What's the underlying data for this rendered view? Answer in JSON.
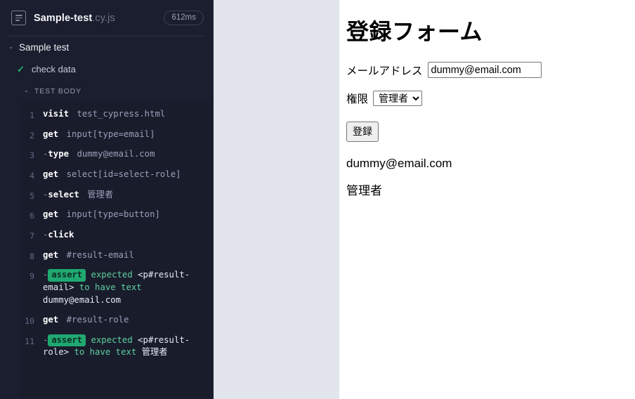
{
  "runner": {
    "spec": {
      "icon": "file-document-icon",
      "name": "Sample-test",
      "extension": ".cy.js",
      "duration": "612ms"
    },
    "suite": {
      "chevron": "⌄",
      "label": "Sample test"
    },
    "test": {
      "status_icon": "✓",
      "label": "check data"
    },
    "hooks": {
      "chevron": "⌄",
      "label": "TEST BODY"
    },
    "commands": [
      {
        "num": "1",
        "dash": "",
        "name": "visit",
        "message": "test_cypress.html",
        "type": "parent"
      },
      {
        "num": "2",
        "dash": "",
        "name": "get",
        "message": "input[type=email]",
        "type": "parent"
      },
      {
        "num": "3",
        "dash": "-",
        "name": "type",
        "message": "dummy@email.com",
        "type": "child"
      },
      {
        "num": "4",
        "dash": "",
        "name": "get",
        "message": "select[id=select-role]",
        "type": "parent"
      },
      {
        "num": "5",
        "dash": "-",
        "name": "select",
        "message": "管理者",
        "type": "child"
      },
      {
        "num": "6",
        "dash": "",
        "name": "get",
        "message": "input[type=button]",
        "type": "parent"
      },
      {
        "num": "7",
        "dash": "-",
        "name": "click",
        "message": "",
        "type": "child"
      },
      {
        "num": "8",
        "dash": "",
        "name": "get",
        "message": "#result-email",
        "type": "parent"
      },
      {
        "num": "9",
        "dash": "-",
        "name": "assert",
        "type": "assertion",
        "assertion": {
          "kw1": "expected",
          "target": "<p#result-email>",
          "kw2": "to have",
          "kw3": "text",
          "value": "dummy@email.com"
        }
      },
      {
        "num": "10",
        "dash": "",
        "name": "get",
        "message": "#result-role",
        "type": "parent"
      },
      {
        "num": "11",
        "dash": "-",
        "name": "assert",
        "type": "assertion",
        "assertion": {
          "kw1": "expected",
          "target": "<p#result-role>",
          "kw2": "to have",
          "kw3": "text",
          "value": "管理者"
        }
      }
    ]
  },
  "app": {
    "heading": "登録フォーム",
    "email_field": {
      "label": "メールアドレス",
      "value": "dummy@email.com",
      "placeholder": ""
    },
    "role_field": {
      "label": "権限",
      "selected": "管理者",
      "options": [
        "管理者"
      ]
    },
    "submit_label": "登録",
    "results": [
      {
        "text": "dummy@email.com"
      },
      {
        "text": "管理者"
      }
    ]
  },
  "colors": {
    "sidebar_bg": "#1b1e2e",
    "command_list_bg": "#191c2b",
    "gutter_bg": "#e2e5ec",
    "pass_green": "#21b573",
    "assert_badge_bg": "#1fa971",
    "assert_keyword": "#5ecfa0"
  }
}
